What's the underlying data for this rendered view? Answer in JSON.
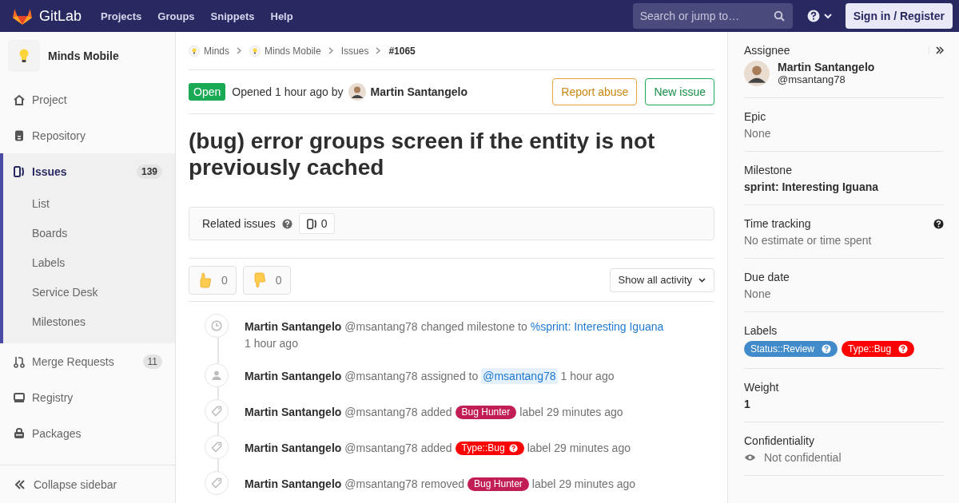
{
  "navbar": {
    "brand": "GitLab",
    "links": [
      "Projects",
      "Groups",
      "Snippets",
      "Help"
    ],
    "search": {
      "placeholder": "Search or jump to…"
    },
    "sign_in": "Sign in / Register"
  },
  "sidebar": {
    "project": "Minds Mobile",
    "items": [
      {
        "kind": "home",
        "label": "Project",
        "selected": false
      },
      {
        "kind": "doc",
        "label": "Repository",
        "selected": false
      },
      {
        "kind": "issues",
        "label": "Issues",
        "count": "139",
        "selected": true,
        "children": [
          {
            "label": "List"
          },
          {
            "label": "Boards"
          },
          {
            "label": "Labels"
          },
          {
            "label": "Service Desk"
          },
          {
            "label": "Milestones"
          }
        ]
      },
      {
        "kind": "merge",
        "label": "Merge Requests",
        "count": "11",
        "selected": false
      },
      {
        "kind": "registry",
        "label": "Registry",
        "selected": false
      },
      {
        "kind": "package",
        "label": "Packages",
        "selected": false
      }
    ],
    "collapse": "Collapse sidebar"
  },
  "breadcrumb": [
    {
      "label": "Minds",
      "avatar": true
    },
    {
      "label": "Minds Mobile",
      "avatar": true
    },
    {
      "label": "Issues",
      "avatar": false
    },
    {
      "label": "#1065",
      "avatar": false
    }
  ],
  "issue": {
    "status": "Open",
    "opened": "Opened 1 hour ago by",
    "author": "Martin Santangelo",
    "actions": [
      {
        "label": "Report abuse",
        "kind": "warning"
      },
      {
        "label": "New issue",
        "kind": "success"
      }
    ],
    "title": "(bug) error groups screen if the entity is not previously cached"
  },
  "related": {
    "label": "Related issues",
    "count": "0"
  },
  "awards": [
    {
      "kind": "thumbsup",
      "count": "0"
    },
    {
      "kind": "thumbsdown",
      "count": "0"
    }
  ],
  "activity_filter": "Show all activity",
  "activity": [
    {
      "kind": "clock",
      "actor": "Martin Santangelo",
      "handle": "@msantang78",
      "parts": [
        {
          "kind": "text",
          "text": "changed milestone to"
        },
        {
          "kind": "link",
          "text": "%sprint: Interesting Iguana"
        }
      ],
      "time": "1 hour ago",
      "time_below": true
    },
    {
      "kind": "user",
      "actor": "Martin Santangelo",
      "handle": "@msantang78",
      "parts": [
        {
          "kind": "text",
          "text": "assigned to"
        },
        {
          "kind": "mention",
          "text": "@msantang78"
        }
      ],
      "time": "1 hour ago",
      "time_below": false
    },
    {
      "kind": "tag",
      "actor": "Martin Santangelo",
      "handle": "@msantang78",
      "parts": [
        {
          "kind": "text",
          "text": "added"
        },
        {
          "kind": "label",
          "text": "Bug Hunter",
          "color": "#c21e56",
          "help": false
        },
        {
          "kind": "text",
          "text": "label"
        }
      ],
      "time": "29 minutes ago",
      "time_below": false
    },
    {
      "kind": "tag",
      "actor": "Martin Santangelo",
      "handle": "@msantang78",
      "parts": [
        {
          "kind": "text",
          "text": "added"
        },
        {
          "kind": "label",
          "text": "Type::Bug",
          "color": "#ff0000",
          "help": true
        },
        {
          "kind": "text",
          "text": "label"
        }
      ],
      "time": "29 minutes ago",
      "time_below": false
    },
    {
      "kind": "tag",
      "actor": "Martin Santangelo",
      "handle": "@msantang78",
      "parts": [
        {
          "kind": "text",
          "text": "removed"
        },
        {
          "kind": "label",
          "text": "Bug Hunter",
          "color": "#c21e56",
          "help": false
        },
        {
          "kind": "text",
          "text": "label"
        }
      ],
      "time": "29 minutes ago",
      "time_below": false
    }
  ],
  "right_sidebar": [
    {
      "kind": "assignee",
      "title": "Assignee",
      "name": "Martin Santangelo",
      "handle": "@msantang78"
    },
    {
      "kind": "muted",
      "title": "Epic",
      "value": "None"
    },
    {
      "kind": "bold",
      "title": "Milestone",
      "value": "sprint: Interesting Iguana"
    },
    {
      "kind": "muted",
      "title": "Time tracking",
      "value": "No estimate or time spent",
      "help": true
    },
    {
      "kind": "muted",
      "title": "Due date",
      "value": "None"
    },
    {
      "kind": "labels",
      "title": "Labels",
      "labels": [
        {
          "text": "Status::Review",
          "color": "#428bca"
        },
        {
          "text": "Type::Bug",
          "color": "#ff0000"
        }
      ]
    },
    {
      "kind": "bold",
      "title": "Weight",
      "value": "1"
    },
    {
      "kind": "confidential",
      "title": "Confidentiality",
      "value": "Not confidential"
    }
  ]
}
